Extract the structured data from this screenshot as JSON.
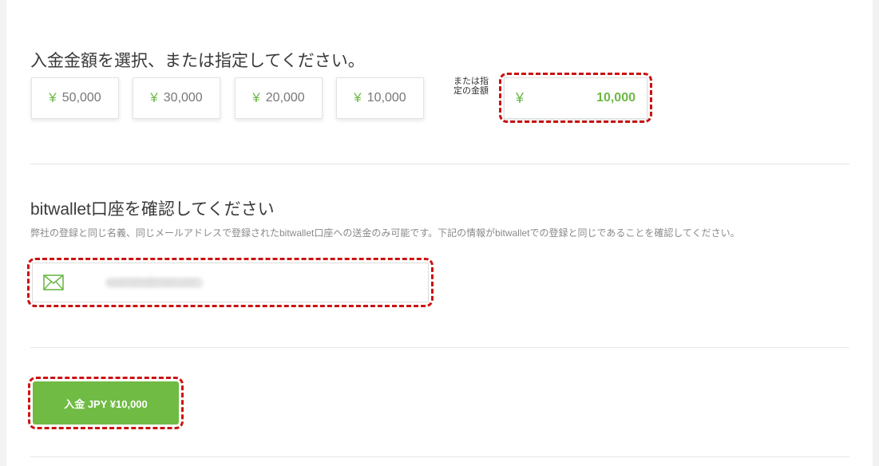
{
  "amount_section": {
    "heading": "入金金額を選択、または指定してください。",
    "currency_symbol": "¥",
    "presets": [
      "50,000",
      "30,000",
      "20,000",
      "10,000"
    ],
    "or_label": "または指定の金額",
    "custom_amount": "10,000"
  },
  "account_section": {
    "heading": "bitwallet口座を確認してください",
    "description": "弊社の登録と同じ名義、同じメールアドレスで登録されたbitwallet口座への送金のみ可能です。下記の情報がbitwalletでの登録と同じであることを確認してください。",
    "email_value": "example@mail.com"
  },
  "submit": {
    "label": "入金 JPY ¥10,000"
  },
  "colors": {
    "accent": "#70bb44",
    "highlight": "#cc1111"
  }
}
